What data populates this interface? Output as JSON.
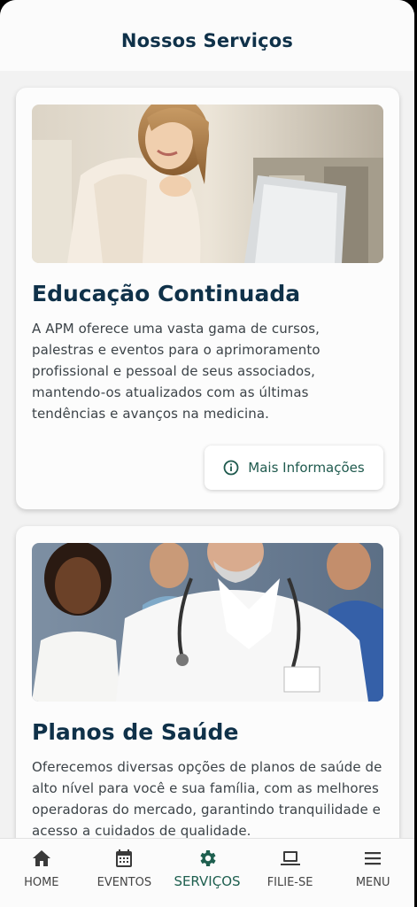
{
  "header": {
    "title": "Nossos Serviços"
  },
  "services": [
    {
      "title": "Educação Continuada",
      "text": "A APM oferece uma vasta gama de cursos, palestras e eventos para o aprimoramento profissional e pessoal de seus associados, mantendo-os atualizados com as últimas tendências e avanços na medicina.",
      "button_label": "Mais Informações"
    },
    {
      "title": "Planos de Saúde",
      "text": "Oferecemos diversas opções de planos de saúde de alto nível para você e sua família, com as melhores operadoras do mercado, garantindo tranquilidade e acesso a cuidados de qualidade."
    }
  ],
  "nav": [
    {
      "label": "HOME",
      "icon": "home-icon"
    },
    {
      "label": "EVENTOS",
      "icon": "calendar-icon"
    },
    {
      "label": "SERVIÇOS",
      "icon": "gear-icon",
      "active": true
    },
    {
      "label": "FILIE-SE",
      "icon": "laptop-icon"
    },
    {
      "label": "MENU",
      "icon": "menu-icon"
    }
  ],
  "colors": {
    "primary_text": "#0f3149",
    "accent": "#1e5f4f",
    "background": "#f2f2f2"
  }
}
